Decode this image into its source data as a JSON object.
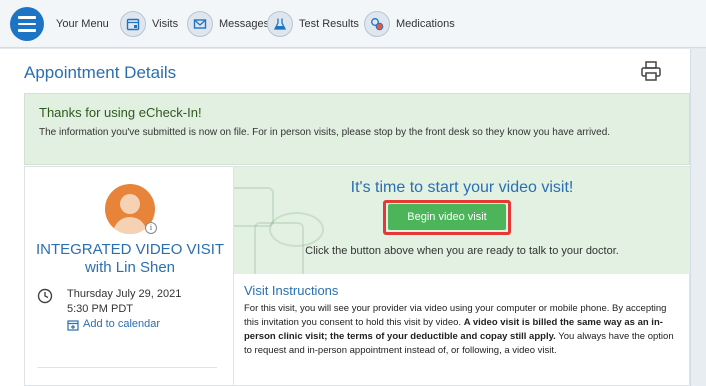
{
  "nav": {
    "menu_label": "Your Menu",
    "items": [
      {
        "label": "Visits",
        "icon": "calendar-icon"
      },
      {
        "label": "Messages",
        "icon": "envelope-icon"
      },
      {
        "label": "Test Results",
        "icon": "flask-icon"
      },
      {
        "label": "Medications",
        "icon": "pills-icon"
      }
    ]
  },
  "page": {
    "title": "Appointment Details",
    "print_icon": "printer-icon"
  },
  "checkin": {
    "title": "Thanks for using eCheck-In!",
    "message": "The information you've submitted is now on file. For in person visits, please stop by the front desk so they know you have arrived."
  },
  "visit": {
    "title": "INTEGRATED VIDEO VISIT with Lin Shen",
    "date": "Thursday July 29, 2021",
    "time": "5:30 PM PDT",
    "add_calendar": "Add to calendar",
    "avatar_badge": "i"
  },
  "video": {
    "heading": "It's time to start your video visit!",
    "button": "Begin video visit",
    "subtext": "Click the button above when you are ready to talk to your doctor."
  },
  "instructions": {
    "title": "Visit Instructions",
    "part1": "For this visit, you will see your provider via video using your computer or mobile phone.  By accepting this invitation you consent to hold this visit by video.  ",
    "bold": "A video visit is billed the same way as an in-person clinic visit; the terms of your deductible and copay still apply.",
    "part2": "  You always have the option to request and in-person appointment instead of, or following, a video visit."
  },
  "colors": {
    "accent": "#2a6fb0",
    "button_green": "#4cb55a",
    "highlight_red": "#e53935",
    "success_bg": "#e1f0e0"
  }
}
